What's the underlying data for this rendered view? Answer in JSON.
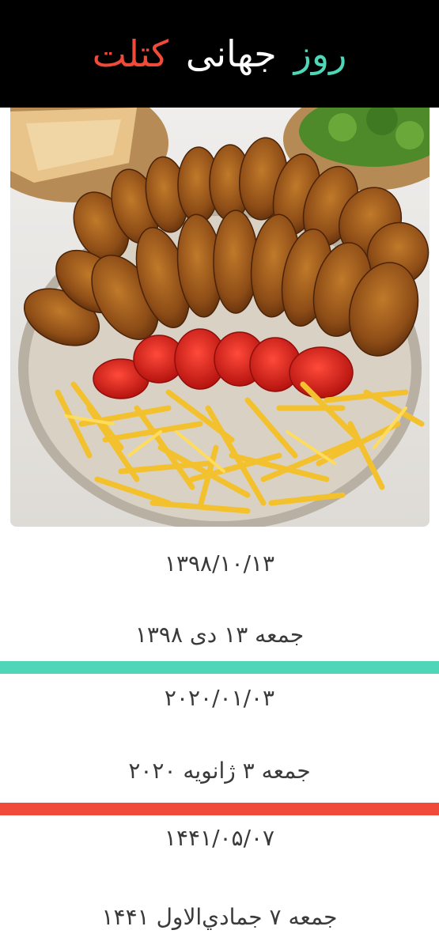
{
  "header": {
    "word1": "روز",
    "word2": "جهانی",
    "word3": "کتلت",
    "color1": "#4fd6b8",
    "color2": "#ffffff",
    "color3": "#f04a3a"
  },
  "dates": {
    "persian_numeric": "۱۳۹۸/۱۰/۱۳",
    "persian_text": "جمعه ۱۳ دی ۱۳۹۸",
    "gregorian_numeric": "۲۰۲۰/۰۱/۰۳",
    "gregorian_text": "جمعه ۳ ژانویه ۲۰۲۰",
    "hijri_numeric": "۱۴۴۱/۰۵/۰۷",
    "hijri_text": "جمعه ۷ جمادي‌الاول ۱۴۴۱"
  },
  "colors": {
    "divider_green": "#4fd6b8",
    "divider_red": "#f04a3a"
  }
}
